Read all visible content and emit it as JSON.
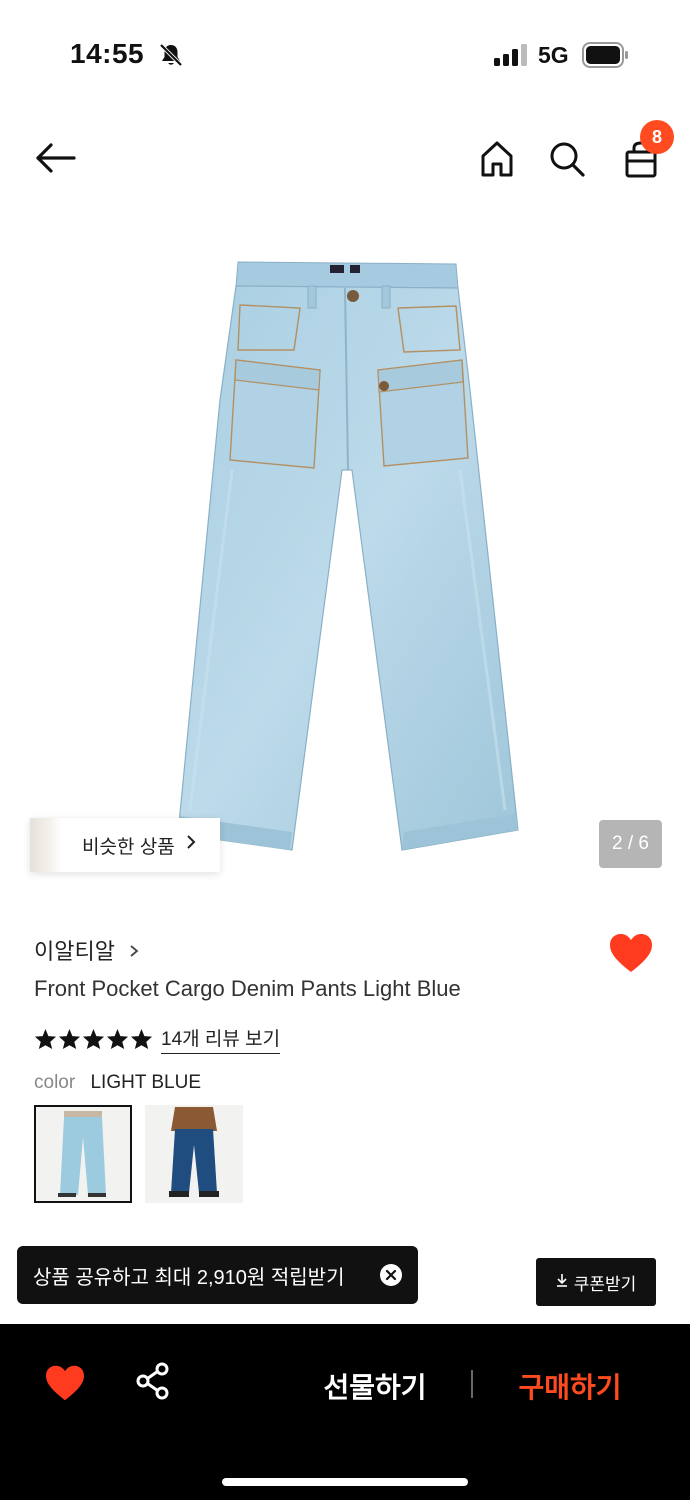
{
  "status_bar": {
    "time": "14:55",
    "network": "5G"
  },
  "top_nav": {
    "cart_count": "8"
  },
  "gallery": {
    "similar_label": "비슷한 상품",
    "page_indicator": "2 / 6"
  },
  "product": {
    "brand": "이알티알",
    "title": "Front Pocket Cargo Denim Pants Light Blue",
    "rating_stars": 5,
    "review_link": "14개 리뷰 보기",
    "color_label": "color",
    "color_value": "LIGHT BLUE",
    "liked": true
  },
  "share_toast": {
    "text": "상품 공유하고 최대 2,910원 적립받기"
  },
  "coupon": {
    "label": "쿠폰받기"
  },
  "bottom_bar": {
    "gift_label": "선물하기",
    "buy_label": "구매하기"
  },
  "colors": {
    "accent": "#ff4b1f",
    "heart": "#ff3b1f",
    "dark": "#111111"
  },
  "icons": [
    "arrow-left-icon",
    "home-icon",
    "search-icon",
    "shopping-bag-icon",
    "heart-icon",
    "share-icon",
    "close-icon",
    "download-icon",
    "star-icon"
  ]
}
